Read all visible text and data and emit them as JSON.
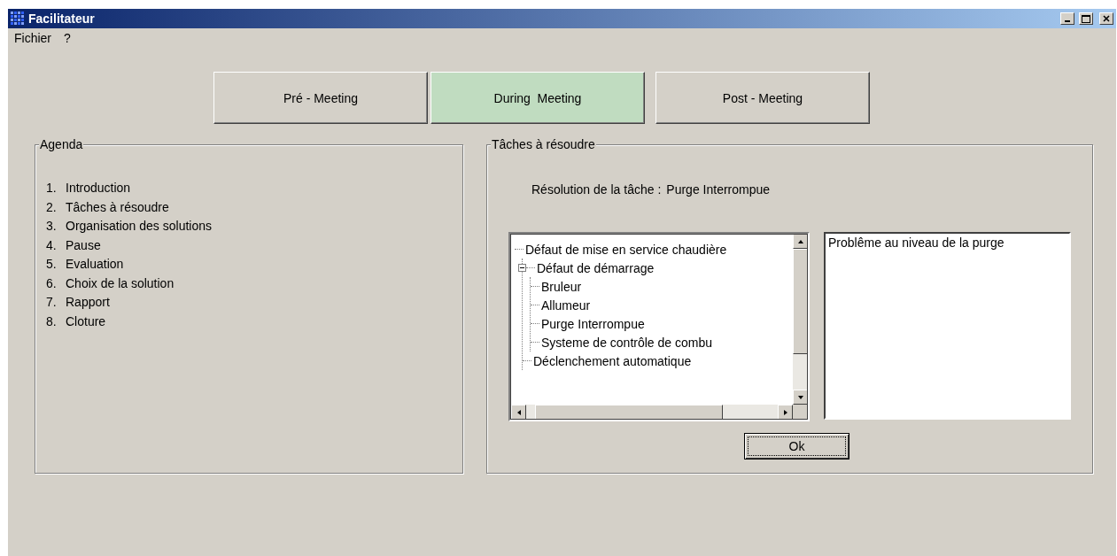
{
  "window": {
    "title": "Facilitateur"
  },
  "menu": [
    {
      "label": "Fichier"
    },
    {
      "label": "?"
    }
  ],
  "phases": [
    {
      "label": "Pré - Meeting",
      "selected": false
    },
    {
      "label": "During  Meeting",
      "selected": true
    },
    {
      "label": "Post - Meeting",
      "selected": false
    }
  ],
  "agenda": {
    "title": "Agenda",
    "items": [
      {
        "number": "1.",
        "label": "Introduction"
      },
      {
        "number": "2.",
        "label": "Tâches à résoudre"
      },
      {
        "number": "3.",
        "label": "Organisation des solutions"
      },
      {
        "number": "4.",
        "label": "Pause"
      },
      {
        "number": "5.",
        "label": "Evaluation"
      },
      {
        "number": "6.",
        "label": "Choix de la solution"
      },
      {
        "number": "7.",
        "label": "Rapport"
      },
      {
        "number": "8.",
        "label": "Cloture"
      }
    ]
  },
  "tasks": {
    "title": "Tâches à résoudre",
    "resolution_label": "Résolution de la tâche :",
    "resolution_value": "Purge Interrompue",
    "tree": [
      {
        "label": "Défaut de mise en service chaudière",
        "children": [
          {
            "label": "Défaut de démarrage",
            "expanded": true,
            "children": [
              {
                "label": "Bruleur"
              },
              {
                "label": "Allumeur"
              },
              {
                "label": "Purge Interrompue"
              },
              {
                "label": "Systeme de contrôle de combu"
              }
            ]
          },
          {
            "label": "Déclenchement automatique"
          }
        ]
      }
    ],
    "description": "Problême au niveau de la purge",
    "ok_button": "Ok"
  }
}
